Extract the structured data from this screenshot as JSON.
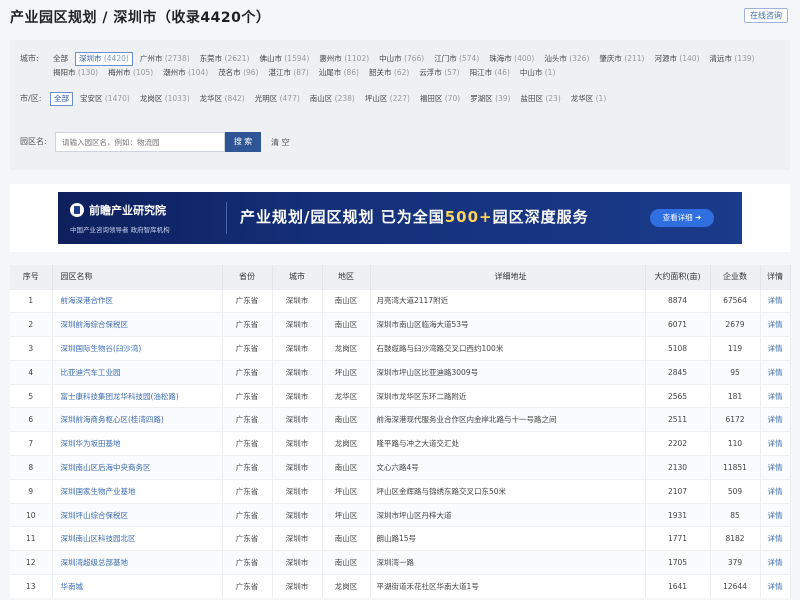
{
  "page": {
    "title": "产业园区规划 / 深圳市（收录4420个）",
    "consult_label": "在线咨询"
  },
  "filters": {
    "city_label": "城市:",
    "cities": [
      {
        "name": "全部",
        "count": "",
        "active": false
      },
      {
        "name": "深圳市",
        "count": "(4420)",
        "active": true
      },
      {
        "name": "广州市",
        "count": "(2738)",
        "active": false
      },
      {
        "name": "东莞市",
        "count": "(2621)",
        "active": false
      },
      {
        "name": "佛山市",
        "count": "(1594)",
        "active": false
      },
      {
        "name": "惠州市",
        "count": "(1102)",
        "active": false
      },
      {
        "name": "中山市",
        "count": "(766)",
        "active": false
      },
      {
        "name": "江门市",
        "count": "(574)",
        "active": false
      },
      {
        "name": "珠海市",
        "count": "(400)",
        "active": false
      },
      {
        "name": "汕头市",
        "count": "(326)",
        "active": false
      },
      {
        "name": "肇庆市",
        "count": "(211)",
        "active": false
      },
      {
        "name": "河源市",
        "count": "(140)",
        "active": false
      },
      {
        "name": "清远市",
        "count": "(139)",
        "active": false
      },
      {
        "name": "揭阳市",
        "count": "(130)",
        "active": false
      },
      {
        "name": "梅州市",
        "count": "(105)",
        "active": false
      },
      {
        "name": "潮州市",
        "count": "(104)",
        "active": false
      },
      {
        "name": "茂名市",
        "count": "(96)",
        "active": false
      },
      {
        "name": "湛江市",
        "count": "(87)",
        "active": false
      },
      {
        "name": "汕尾市",
        "count": "(86)",
        "active": false
      },
      {
        "name": "韶关市",
        "count": "(62)",
        "active": false
      },
      {
        "name": "云浮市",
        "count": "(57)",
        "active": false
      },
      {
        "name": "阳江市",
        "count": "(46)",
        "active": false
      },
      {
        "name": "中山市",
        "count": "(1)",
        "active": false
      }
    ],
    "district_label": "市/区:",
    "districts": [
      {
        "name": "全部",
        "count": "",
        "active": true
      },
      {
        "name": "宝安区",
        "count": "(1470)",
        "active": false
      },
      {
        "name": "龙岗区",
        "count": "(1033)",
        "active": false
      },
      {
        "name": "龙华区",
        "count": "(842)",
        "active": false
      },
      {
        "name": "光明区",
        "count": "(477)",
        "active": false
      },
      {
        "name": "南山区",
        "count": "(238)",
        "active": false
      },
      {
        "name": "坪山区",
        "count": "(227)",
        "active": false
      },
      {
        "name": "福田区",
        "count": "(70)",
        "active": false
      },
      {
        "name": "罗湖区",
        "count": "(39)",
        "active": false
      },
      {
        "name": "盐田区",
        "count": "(23)",
        "active": false
      },
      {
        "name": "龙华区",
        "count": "(1)",
        "active": false
      }
    ],
    "search_label": "园区名:",
    "search_placeholder": "请输入园区名，例如：物流园",
    "search_button": "搜 索",
    "clear_label": "清 空"
  },
  "banner": {
    "logo_text": "前瞻产业研究院",
    "subtitle": "中国产业咨询领导者  政府智库机构",
    "headline_prefix": "产业规划/园区规划  已为全国",
    "headline_highlight": "500+",
    "headline_suffix": "园区深度服务",
    "button_label": "查看详细 ➜"
  },
  "table": {
    "headers": [
      "序号",
      "园区名称",
      "省份",
      "城市",
      "地区",
      "详细地址",
      "大约面积(亩)",
      "企业数",
      "详情"
    ],
    "rows": [
      [
        "1",
        "前海深港合作区",
        "广东省",
        "深圳市",
        "南山区",
        "月亮湾大道2117附近",
        "8874",
        "67564",
        "详情"
      ],
      [
        "2",
        "深圳前海综合保税区",
        "广东省",
        "深圳市",
        "南山区",
        "深圳市南山区临海大道53号",
        "6071",
        "2679",
        "详情"
      ],
      [
        "3",
        "深圳国际生物谷(臼沙湾)",
        "广东省",
        "深圳市",
        "龙岗区",
        "石鼓缆路与臼沙湾路交叉口西约100米",
        "5108",
        "119",
        "详情"
      ],
      [
        "4",
        "比亚迪汽车工业园",
        "广东省",
        "深圳市",
        "坪山区",
        "深圳市坪山区比亚迪路3009号",
        "2845",
        "95",
        "详情"
      ],
      [
        "5",
        "富士康科技集团龙华科技园(油松路)",
        "广东省",
        "深圳市",
        "龙华区",
        "深圳市龙华区东环二路附近",
        "2565",
        "181",
        "详情"
      ],
      [
        "6",
        "深圳前海商务枢心区(桂湾四路)",
        "广东省",
        "深圳市",
        "南山区",
        "前海深港现代服务业合作区内金岸北路与十一号路之间",
        "2511",
        "6172",
        "详情"
      ],
      [
        "7",
        "深圳华为坂田基地",
        "广东省",
        "深圳市",
        "龙岗区",
        "隆平路与冲之大道交汇处",
        "2202",
        "110",
        "详情"
      ],
      [
        "8",
        "深圳南山区后海中央商务区",
        "广东省",
        "深圳市",
        "南山区",
        "文心六路4号",
        "2130",
        "11851",
        "详情"
      ],
      [
        "9",
        "深圳国家生物产业基地",
        "广东省",
        "深圳市",
        "坪山区",
        "坪山区金辉路与锦绣东路交叉口东50米",
        "2107",
        "509",
        "详情"
      ],
      [
        "10",
        "深圳坪山综合保税区",
        "广东省",
        "深圳市",
        "坪山区",
        "深圳市坪山区丹梓大道",
        "1931",
        "85",
        "详情"
      ],
      [
        "11",
        "深圳南山区科技园北区",
        "广东省",
        "深圳市",
        "南山区",
        "朗山路15号",
        "1771",
        "8182",
        "详情"
      ],
      [
        "12",
        "深圳湾超级总部基地",
        "广东省",
        "深圳市",
        "南山区",
        "深圳湾一路",
        "1705",
        "379",
        "详情"
      ],
      [
        "13",
        "华南城",
        "广东省",
        "深圳市",
        "龙岗区",
        "平湖街道禾花社区华南大道1号",
        "1641",
        "12644",
        "详情"
      ]
    ]
  }
}
